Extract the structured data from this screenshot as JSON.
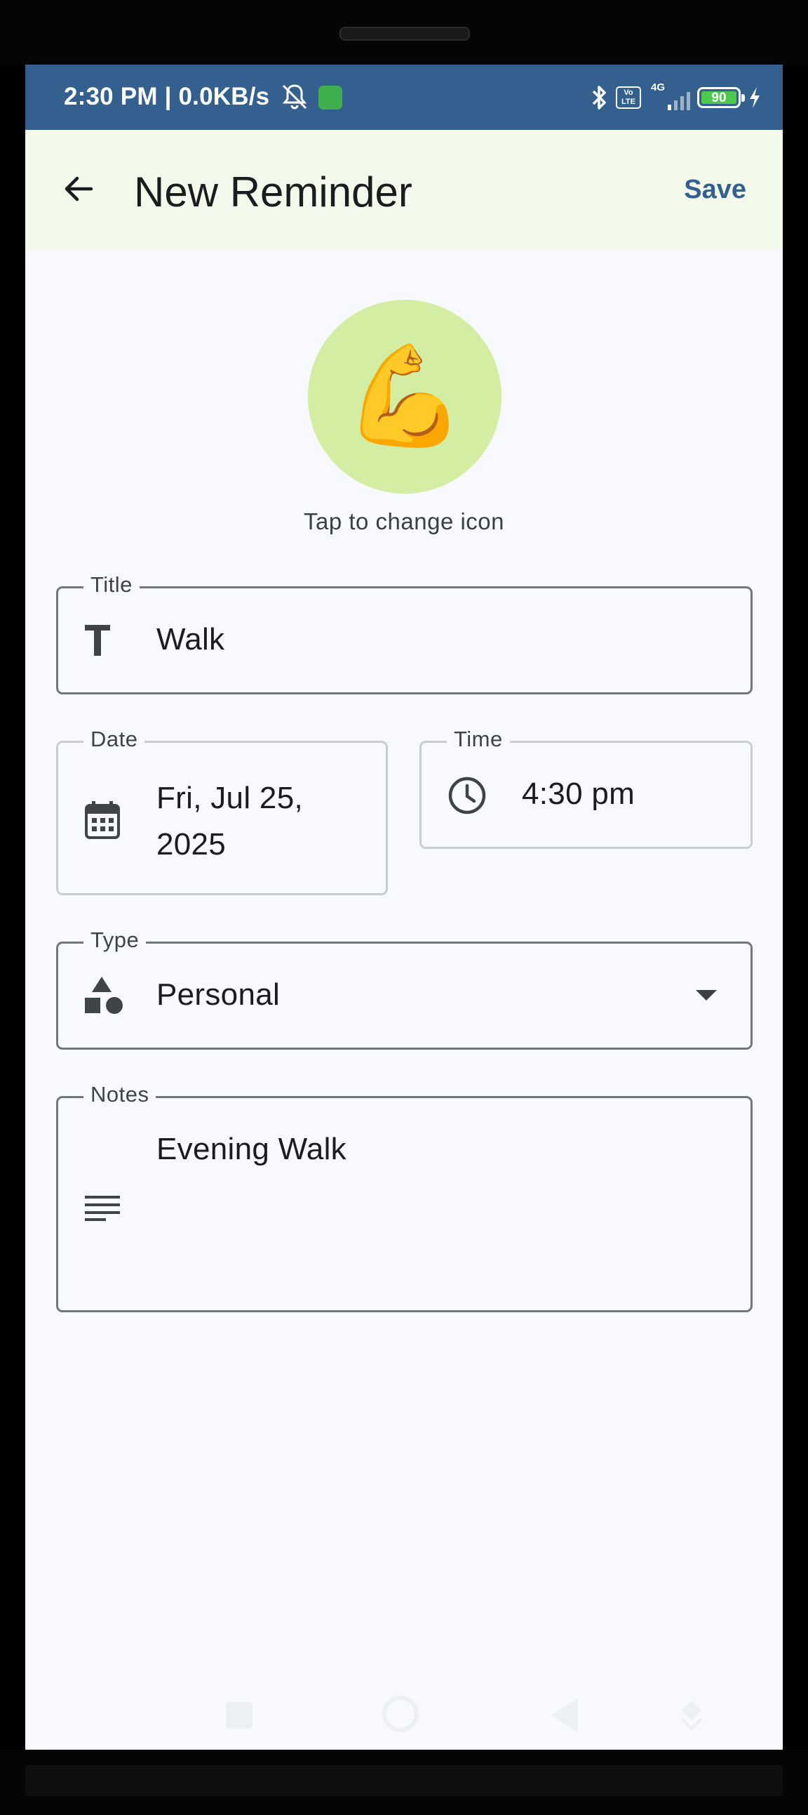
{
  "status_bar": {
    "left_text": "2:30 PM | 0.0KB/s",
    "volte": "Vo LTE",
    "network": "4G",
    "battery": "90",
    "background": "#33608F"
  },
  "app_bar": {
    "title": "New Reminder",
    "save_label": "Save",
    "back_icon": "arrow-back-icon"
  },
  "icon_picker": {
    "emoji": "💪",
    "hint": "Tap to change icon",
    "circle_color": "#D3EDA2"
  },
  "form": {
    "title": {
      "label": "Title",
      "value": "Walk",
      "icon": "text-icon"
    },
    "date": {
      "label": "Date",
      "value": "Fri, Jul 25, 2025",
      "icon": "calendar-icon"
    },
    "time": {
      "label": "Time",
      "value": "4:30 pm",
      "icon": "clock-icon"
    },
    "type": {
      "label": "Type",
      "value": "Personal",
      "icon": "shapes-icon"
    },
    "notes": {
      "label": "Notes",
      "value": "Evening Walk",
      "icon": "notes-icon"
    }
  },
  "colors": {
    "accent": "#33608F",
    "app_bar_bg": "#F3FAEB",
    "screen_bg": "#F7F9FF"
  }
}
